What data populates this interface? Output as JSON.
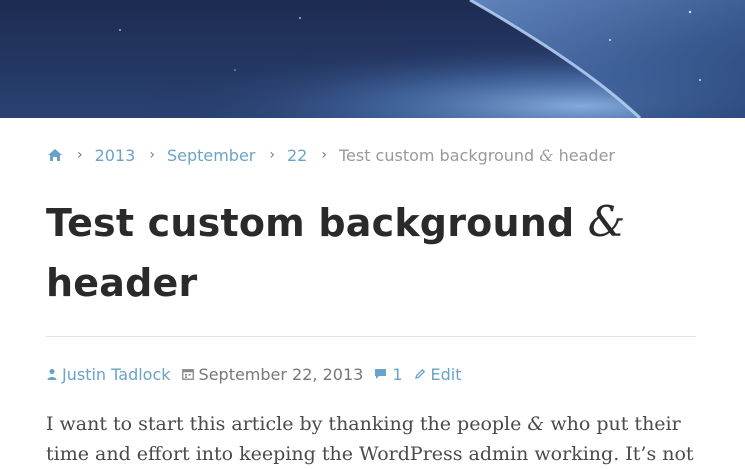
{
  "colors": {
    "link": "#6aa3c8",
    "muted": "#999999",
    "title": "#2a2a2a",
    "text": "#4a4a4a",
    "header_bg": "#1d2b52"
  },
  "breadcrumb": {
    "home_icon": "home-icon",
    "items": [
      {
        "label": "2013"
      },
      {
        "label": "September"
      },
      {
        "label": "22"
      }
    ],
    "current_before": "Test custom background ",
    "current_amp": "&",
    "current_after": " header"
  },
  "post": {
    "title_part1": "Test custom background ",
    "title_amp": "&",
    "title_part2": "header",
    "meta": {
      "author": "Justin Tadlock",
      "date": "September 22, 2013",
      "comments": "1",
      "edit": "Edit"
    },
    "content_part1": "I want to start this article by thanking the people ",
    "content_amp": "&",
    "content_part2": " who put their time and effort into keeping the WordPress admin working. It’s not"
  }
}
